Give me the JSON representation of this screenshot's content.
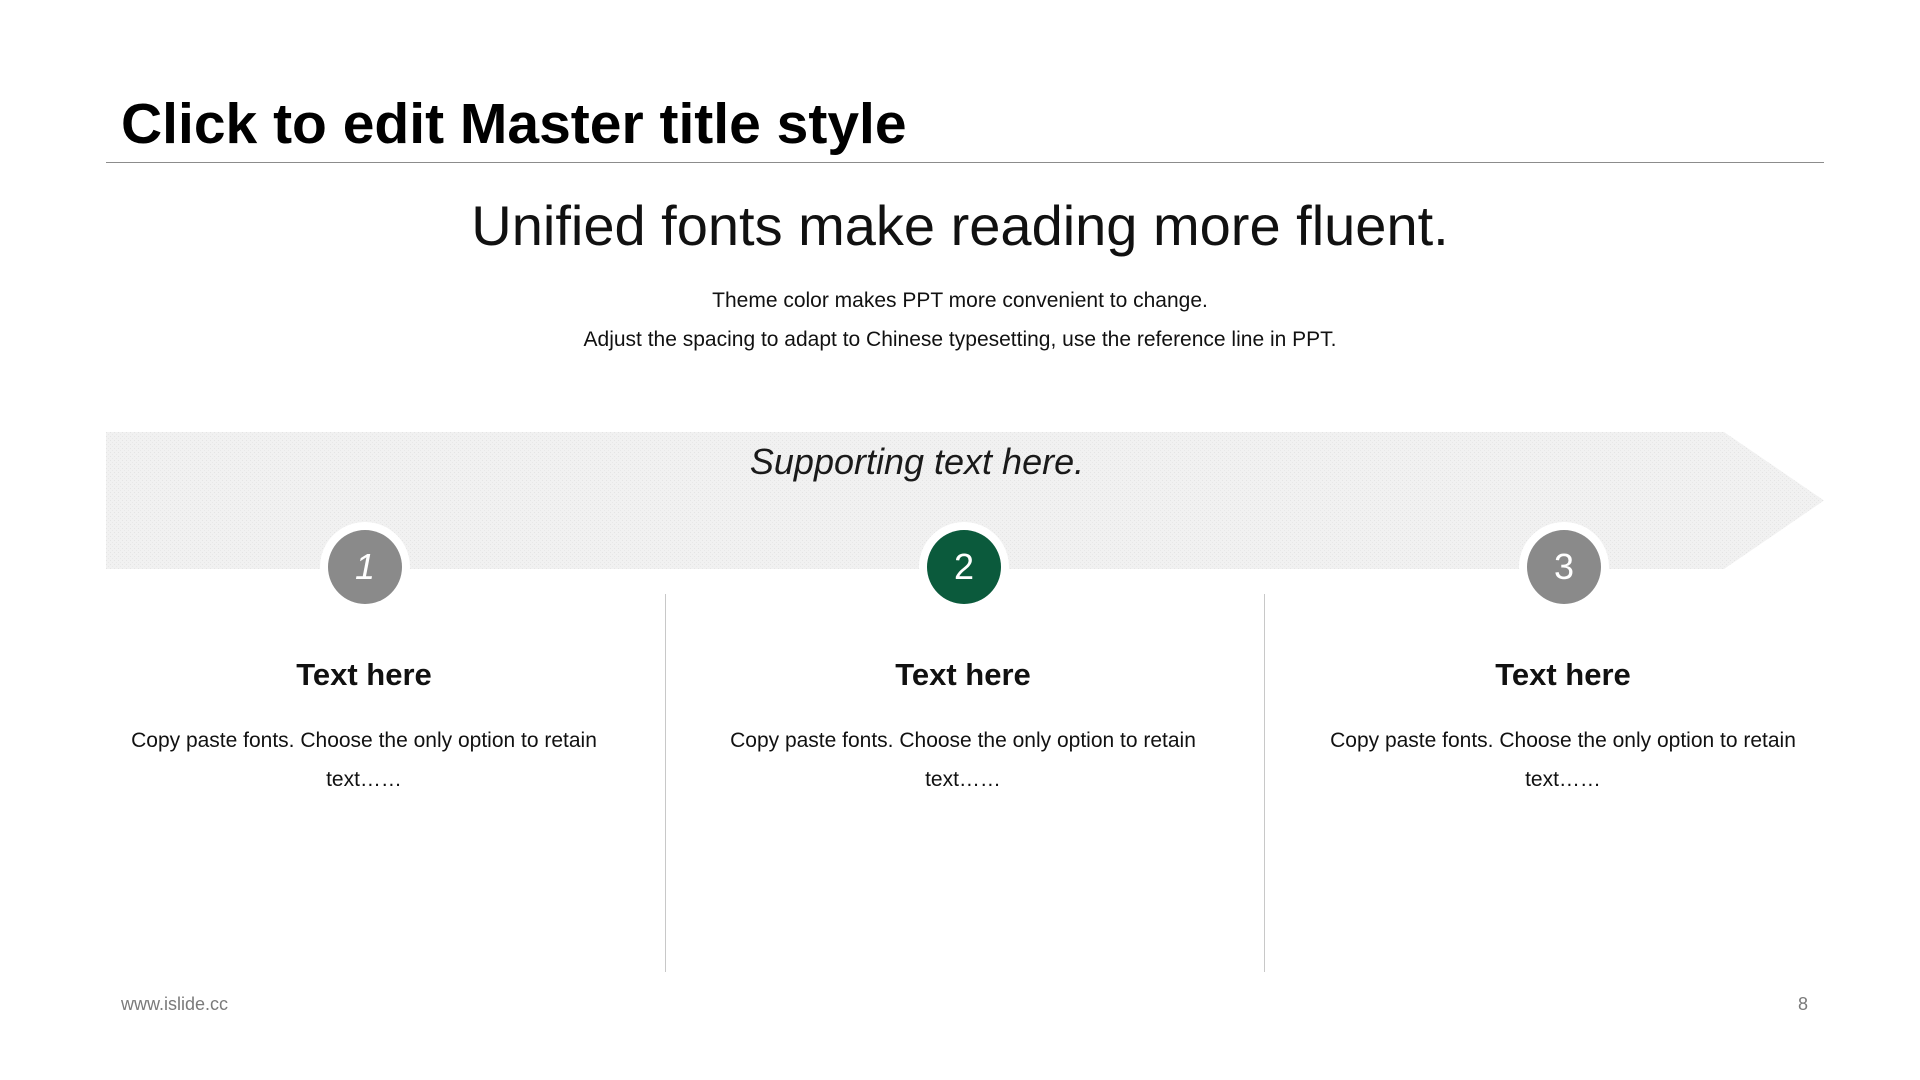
{
  "slide": {
    "title": "Click to edit Master title style",
    "headline": "Unified fonts make reading more fluent.",
    "subtitle_lines": [
      "Theme color makes PPT more convenient  to change.",
      "Adjust the spacing to adapt to Chinese  typesetting,  use the reference line  in PPT."
    ],
    "supporting_text": "Supporting text here."
  },
  "steps": [
    {
      "number": "1",
      "heading": "Text here",
      "body": "Copy paste fonts. Choose the only option to retain text……"
    },
    {
      "number": "2",
      "heading": "Text here",
      "body": "Copy paste fonts. Choose the only option to retain text……"
    },
    {
      "number": "3",
      "heading": "Text here",
      "body": "Copy paste fonts. Choose the only option to retain text……"
    }
  ],
  "footer": {
    "url": "www.islide.cc",
    "page_number": "8"
  },
  "colors": {
    "accent": "#0b5a3c",
    "step_inactive": "#8a8a8a",
    "band": "#efefef",
    "rule": "#8c8c8c"
  }
}
